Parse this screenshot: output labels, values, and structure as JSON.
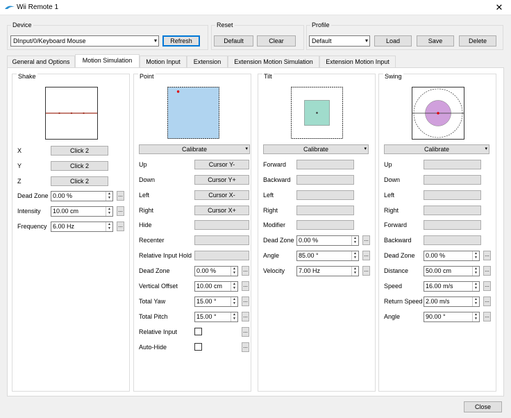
{
  "window": {
    "title": "Wii Remote 1",
    "close_glyph": "✕"
  },
  "device": {
    "group_label": "Device",
    "selected": "DInput/0/Keyboard Mouse",
    "refresh_label": "Refresh"
  },
  "reset": {
    "group_label": "Reset",
    "default_label": "Default",
    "clear_label": "Clear"
  },
  "profile": {
    "group_label": "Profile",
    "selected": "Default",
    "load_label": "Load",
    "save_label": "Save",
    "delete_label": "Delete"
  },
  "tabs": [
    {
      "label": "General and Options",
      "active": false
    },
    {
      "label": "Motion Simulation",
      "active": true
    },
    {
      "label": "Motion Input",
      "active": false
    },
    {
      "label": "Extension",
      "active": false
    },
    {
      "label": "Extension Motion Simulation",
      "active": false
    },
    {
      "label": "Extension Motion Input",
      "active": false
    }
  ],
  "shake": {
    "label": "Shake",
    "mappings": [
      {
        "label": "X",
        "value": "Click 2"
      },
      {
        "label": "Y",
        "value": "Click 2"
      },
      {
        "label": "Z",
        "value": "Click 2"
      }
    ],
    "settings": [
      {
        "label": "Dead Zone",
        "value": "0.00 %"
      },
      {
        "label": "Intensity",
        "value": "10.00 cm"
      },
      {
        "label": "Frequency",
        "value": "6.00 Hz"
      }
    ]
  },
  "point": {
    "label": "Point",
    "calibrate_label": "Calibrate",
    "mappings": [
      {
        "label": "Up",
        "value": "Cursor Y-"
      },
      {
        "label": "Down",
        "value": "Cursor Y+"
      },
      {
        "label": "Left",
        "value": "Cursor X-"
      },
      {
        "label": "Right",
        "value": "Cursor X+"
      },
      {
        "label": "Hide",
        "value": ""
      },
      {
        "label": "Recenter",
        "value": ""
      },
      {
        "label": "Relative Input Hold",
        "value": ""
      }
    ],
    "settings": [
      {
        "label": "Dead Zone",
        "value": "0.00 %"
      },
      {
        "label": "Vertical Offset",
        "value": "10.00 cm"
      },
      {
        "label": "Total Yaw",
        "value": "15.00 °"
      },
      {
        "label": "Total Pitch",
        "value": "15.00 °"
      }
    ],
    "checks": [
      {
        "label": "Relative Input",
        "checked": false
      },
      {
        "label": "Auto-Hide",
        "checked": false
      }
    ]
  },
  "tilt": {
    "label": "Tilt",
    "calibrate_label": "Calibrate",
    "mappings": [
      {
        "label": "Forward",
        "value": ""
      },
      {
        "label": "Backward",
        "value": ""
      },
      {
        "label": "Left",
        "value": ""
      },
      {
        "label": "Right",
        "value": ""
      },
      {
        "label": "Modifier",
        "value": ""
      }
    ],
    "settings": [
      {
        "label": "Dead Zone",
        "value": "0.00 %"
      },
      {
        "label": "Angle",
        "value": "85.00 °"
      },
      {
        "label": "Velocity",
        "value": "7.00 Hz"
      }
    ]
  },
  "swing": {
    "label": "Swing",
    "calibrate_label": "Calibrate",
    "mappings": [
      {
        "label": "Up",
        "value": ""
      },
      {
        "label": "Down",
        "value": ""
      },
      {
        "label": "Left",
        "value": ""
      },
      {
        "label": "Right",
        "value": ""
      },
      {
        "label": "Forward",
        "value": ""
      },
      {
        "label": "Backward",
        "value": ""
      }
    ],
    "settings": [
      {
        "label": "Dead Zone",
        "value": "0.00 %"
      },
      {
        "label": "Distance",
        "value": "50.00 cm"
      },
      {
        "label": "Speed",
        "value": "16.00 m/s"
      },
      {
        "label": "Return Speed",
        "value": "2.00 m/s"
      },
      {
        "label": "Angle",
        "value": "90.00 °"
      }
    ]
  },
  "footer": {
    "close_label": "Close"
  },
  "glyphs": {
    "ellipsis": "...",
    "dropdown": "▾",
    "spin_up": "▲",
    "spin_down": "▼"
  },
  "colors": {
    "point_area": "#b0d4f0",
    "tilt_area": "#a0dccc",
    "swing_area": "#d0a0dc",
    "cursor_dot": "#e00000",
    "shake_line": "#a03020"
  }
}
